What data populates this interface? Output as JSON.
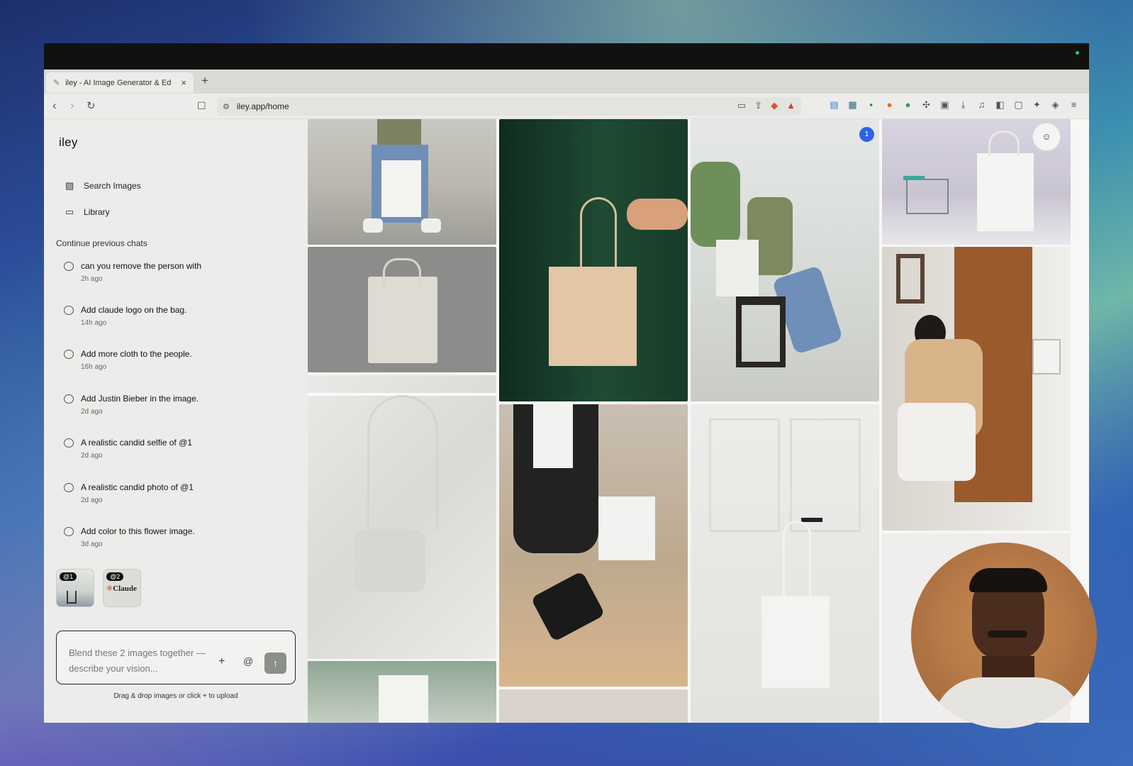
{
  "browser": {
    "tab_title": "iley - AI Image Generator & Ed",
    "url": "iley.app/home",
    "new_tab_label": "+",
    "close_tab_label": "×"
  },
  "sidebar": {
    "brand": "iley",
    "nav": [
      {
        "label": "Search Images",
        "icon": "image-icon"
      },
      {
        "label": "Library",
        "icon": "folder-icon"
      }
    ],
    "section_label": "Continue previous chats",
    "chats": [
      {
        "title": "can you remove the person with",
        "time": "2h ago"
      },
      {
        "title": "Add claude logo on the bag.",
        "time": "14h ago"
      },
      {
        "title": "Add more cloth to the people.",
        "time": "16h ago"
      },
      {
        "title": "Add Justin Bieber in the image.",
        "time": "2d ago"
      },
      {
        "title": "A realistic candid selfie of @1",
        "time": "2d ago"
      },
      {
        "title": "A realistic candid photo of @1",
        "time": "2d ago"
      },
      {
        "title": "Add color to this flower image.",
        "time": "3d ago"
      }
    ],
    "attachments": [
      {
        "tag": "@1"
      },
      {
        "tag": "@2",
        "logo_text": "Claude"
      }
    ]
  },
  "composer": {
    "placeholder": "Blend these 2 images together — describe your vision...",
    "plus_label": "+",
    "mention_label": "@",
    "send_icon": "arrow-up-icon",
    "hint": "Drag & drop images or click + to upload"
  },
  "gallery": {
    "badge": "1",
    "profile_icon": "user-icon"
  }
}
